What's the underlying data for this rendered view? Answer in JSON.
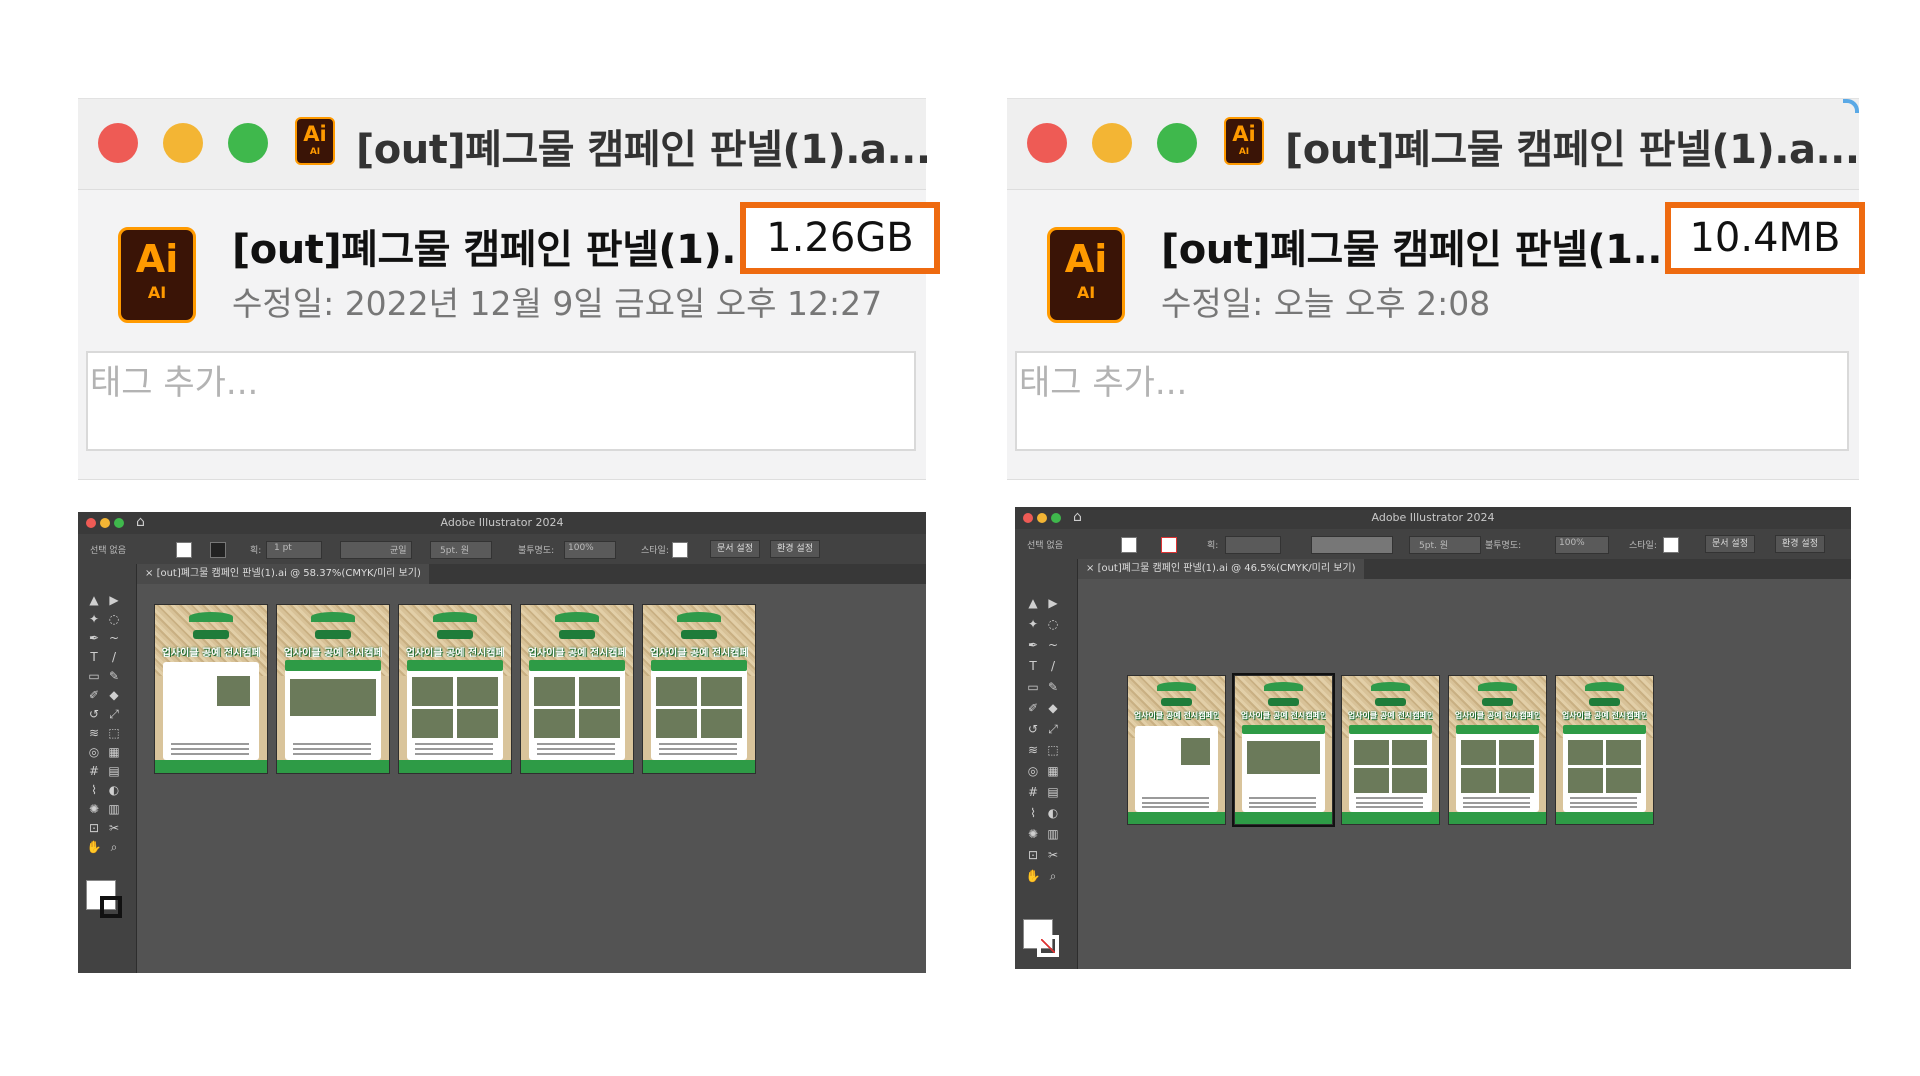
{
  "panels": [
    {
      "window_title": "[out]폐그물 캠페인 판넬(1).a...",
      "icon_label_top": "Ai",
      "icon_label_bottom": "AI",
      "file_name": "[out]폐그물 캠페인 판넬(1)...",
      "file_size": "1.26GB",
      "modified": "수정일: 2022년 12월 9일 금요일 오후 12:27",
      "tag_placeholder": "태그 추가..."
    },
    {
      "window_title": "[out]폐그물 캠페인 판넬(1).a...",
      "icon_label_top": "Ai",
      "icon_label_bottom": "AI",
      "file_name": "[out]폐그물 캠페인 판넬(1...",
      "file_size": "10.4MB",
      "modified": "수정일: 오늘 오후 2:08",
      "tag_placeholder": "태그 추가..."
    }
  ],
  "illustrator": [
    {
      "app_title": "Adobe Illustrator 2024",
      "selection": "선택 없음",
      "stroke_label": "획:",
      "stroke_value": "1 pt",
      "profile": "균일",
      "brush": "5pt. 원",
      "opacity_label": "불투명도:",
      "opacity": "100%",
      "style_label": "스타일:",
      "doc_setup": "문서 설정",
      "prefs": "환경 설정",
      "tab": "[out]폐그물 캠페인 판넬(1).ai @ 58.37%(CMYK/미리 보기)",
      "artboard_headline": "업사이클 공예 전시캠페인"
    },
    {
      "app_title": "Adobe Illustrator 2024",
      "selection": "선택 없음",
      "stroke_label": "획:",
      "brush": "5pt. 원",
      "opacity_label": "불투명도:",
      "opacity": "100%",
      "style_label": "스타일:",
      "doc_setup": "문서 설정",
      "prefs": "환경 설정",
      "tab": "[out]폐그물 캠페인 판넬(1).ai @ 46.5%(CMYK/미리 보기)",
      "artboard_headline": "업사이클 공예 전시캠페인"
    }
  ],
  "colors": {
    "highlight": "#ee6a10",
    "campaign_green": "#2e9b46",
    "illustrator_bg": "#535353"
  },
  "tool_icons": [
    "selection-icon",
    "direct-selection-icon",
    "magic-wand-icon",
    "lasso-icon",
    "pen-icon",
    "curvature-icon",
    "type-icon",
    "line-icon",
    "rectangle-icon",
    "paintbrush-icon",
    "shaper-icon",
    "eraser-icon",
    "rotate-icon",
    "scale-icon",
    "width-icon",
    "free-transform-icon",
    "shape-builder-icon",
    "perspective-icon",
    "mesh-icon",
    "gradient-icon",
    "eyedropper-icon",
    "blend-icon",
    "symbol-sprayer-icon",
    "graph-icon",
    "artboard-icon",
    "slice-icon",
    "hand-icon",
    "zoom-icon"
  ]
}
